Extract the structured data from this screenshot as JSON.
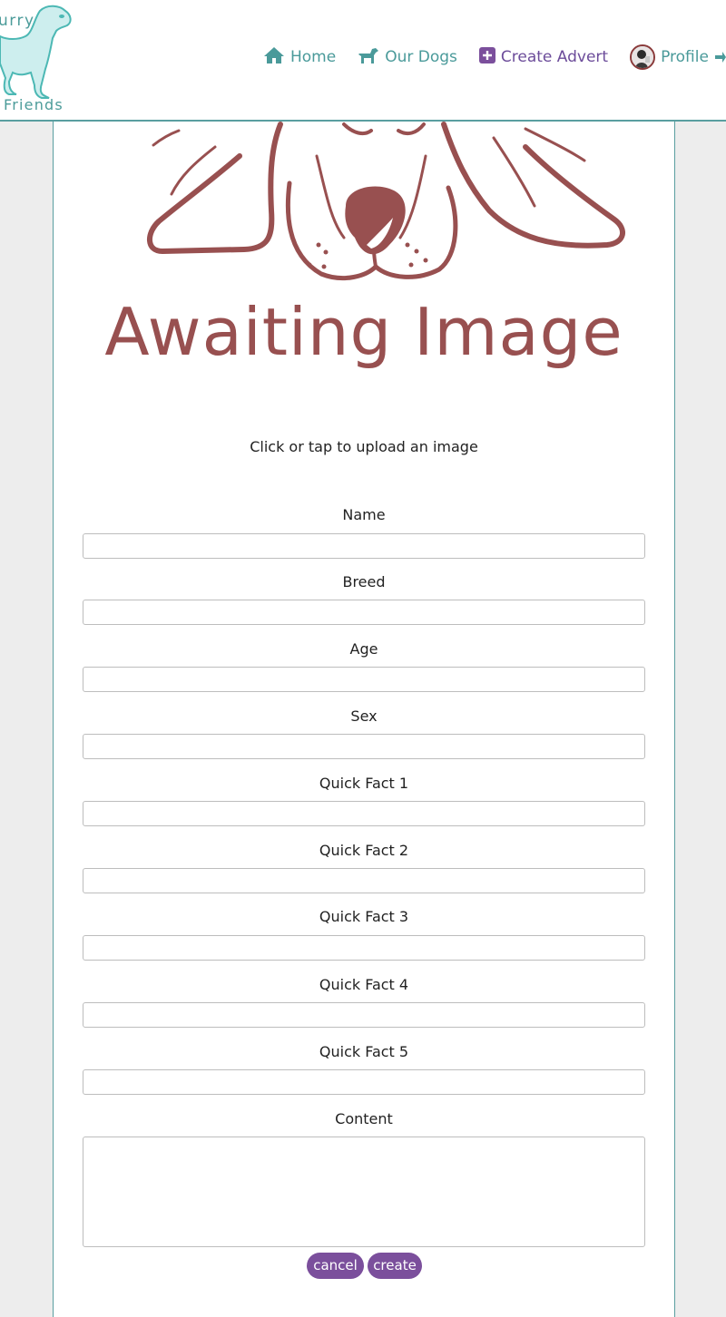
{
  "brand": {
    "top_text": "urry",
    "bottom_text": "Friends"
  },
  "nav": {
    "home": "Home",
    "our_dogs": "Our Dogs",
    "create_advert": "Create Advert",
    "profile": "Profile"
  },
  "colors": {
    "teal": "#4a9a9a",
    "purple": "#7b4f9c",
    "placeholder_red": "#985050"
  },
  "image_upload": {
    "placeholder_text": "Awaiting Image",
    "hint": "Click or tap to upload an image"
  },
  "form": {
    "fields": [
      {
        "label": "Name",
        "value": ""
      },
      {
        "label": "Breed",
        "value": ""
      },
      {
        "label": "Age",
        "value": ""
      },
      {
        "label": "Sex",
        "value": ""
      },
      {
        "label": "Quick Fact 1",
        "value": ""
      },
      {
        "label": "Quick Fact 2",
        "value": ""
      },
      {
        "label": "Quick Fact 3",
        "value": ""
      },
      {
        "label": "Quick Fact 4",
        "value": ""
      },
      {
        "label": "Quick Fact 5",
        "value": ""
      }
    ],
    "content": {
      "label": "Content",
      "value": ""
    },
    "cancel_label": "cancel",
    "create_label": "create"
  }
}
